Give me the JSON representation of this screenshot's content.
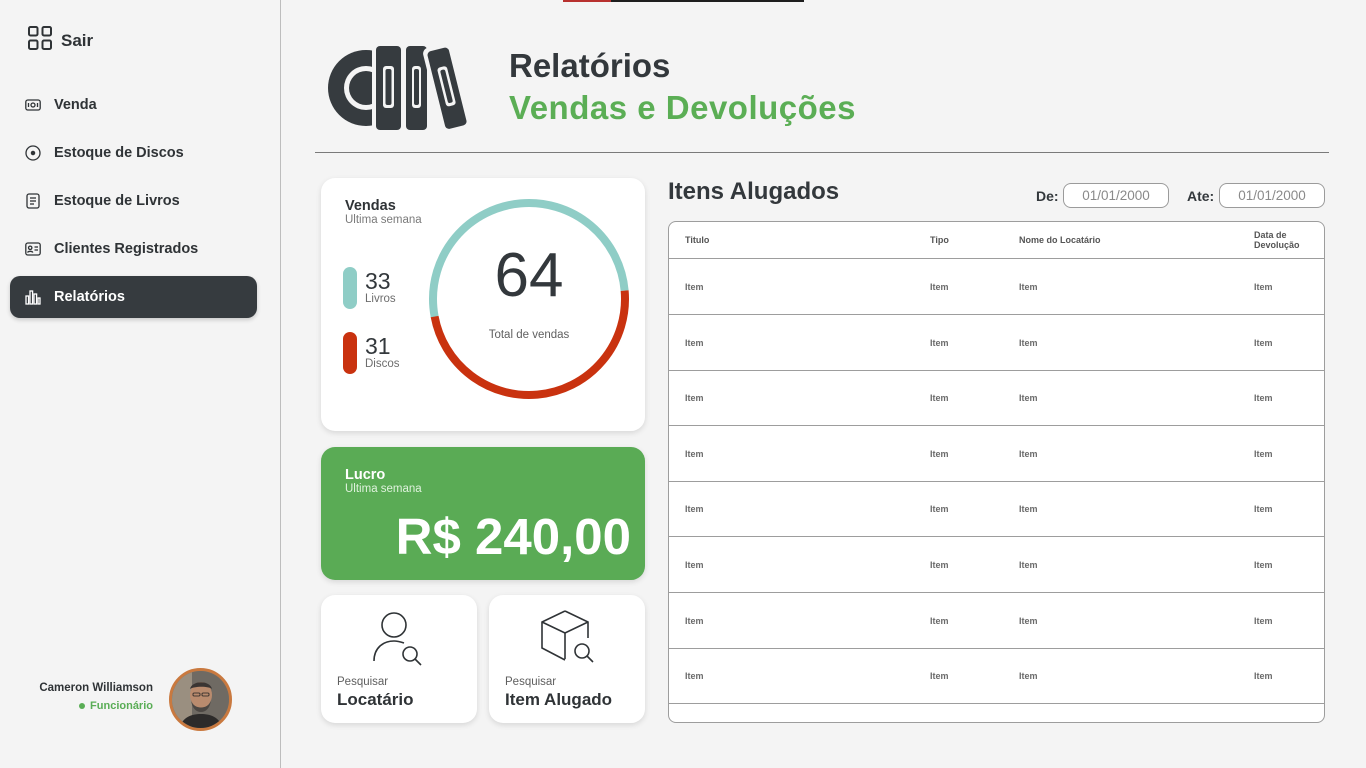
{
  "sidebar": {
    "logout_label": "Sair",
    "items": [
      {
        "label": "Venda",
        "icon": "cash-icon"
      },
      {
        "label": "Estoque de Discos",
        "icon": "disc-icon"
      },
      {
        "label": "Estoque de Livros",
        "icon": "book-icon"
      },
      {
        "label": "Clientes Registrados",
        "icon": "contact-card-icon"
      },
      {
        "label": "Relatórios",
        "icon": "bar-chart-icon",
        "active": true
      }
    ],
    "user": {
      "name": "Cameron Williamson",
      "role": "Funcionário"
    }
  },
  "header": {
    "title": "Relatórios",
    "subtitle": "Vendas e Devoluções"
  },
  "sales": {
    "title": "Vendas",
    "period": "Ultima semana",
    "books": {
      "value": "33",
      "label": "Livros"
    },
    "discs": {
      "value": "31",
      "label": "Discos"
    },
    "total": "64",
    "total_label": "Total de vendas",
    "colors": {
      "books": "#8fcdc6",
      "discs": "#c9320f",
      "profit": "#5aab55",
      "accent": "#5bae55"
    }
  },
  "profit": {
    "title": "Lucro",
    "period": "Ultima semana",
    "value": "R$ 240,00"
  },
  "search": {
    "tenant": {
      "sub": "Pesquisar",
      "main": "Locatário"
    },
    "item": {
      "sub": "Pesquisar",
      "main": "Item Alugado"
    }
  },
  "rented": {
    "title": "Itens Alugados",
    "from_label": "De:",
    "from_value": "01/01/2000",
    "to_label": "Ate:",
    "to_value": "01/01/2000",
    "columns": [
      "Titulo",
      "Tipo",
      "Nome do Locatário",
      "Data de\nDevolução"
    ],
    "rows": [
      [
        "Item",
        "Item",
        "Item",
        "Item"
      ],
      [
        "Item",
        "Item",
        "Item",
        "Item"
      ],
      [
        "Item",
        "Item",
        "Item",
        "Item"
      ],
      [
        "Item",
        "Item",
        "Item",
        "Item"
      ],
      [
        "Item",
        "Item",
        "Item",
        "Item"
      ],
      [
        "Item",
        "Item",
        "Item",
        "Item"
      ],
      [
        "Item",
        "Item",
        "Item",
        "Item"
      ],
      [
        "Item",
        "Item",
        "Item",
        "Item"
      ]
    ]
  }
}
